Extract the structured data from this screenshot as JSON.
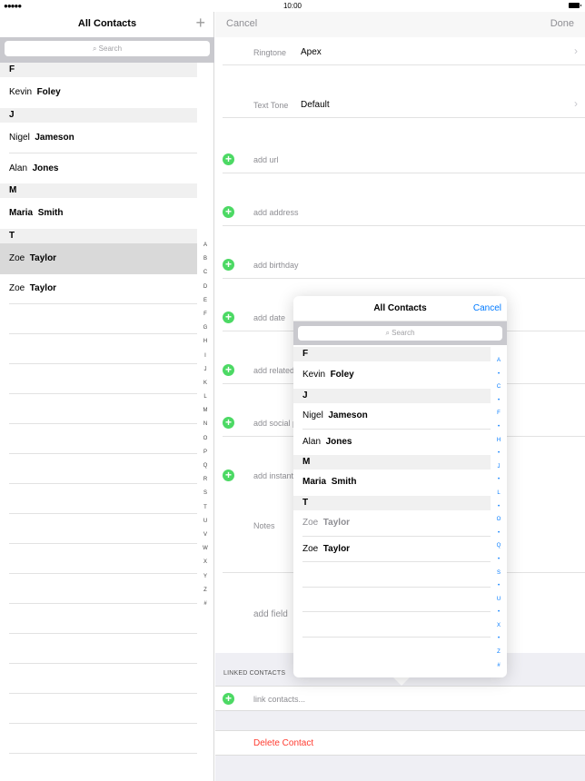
{
  "status_bar": {
    "signal": "●●●●●",
    "time": "10:00"
  },
  "left": {
    "title": "All Contacts",
    "add_icon": "plus-icon",
    "add_label": "+",
    "search_placeholder": "Search",
    "sections": [
      {
        "letter": "F",
        "contacts": [
          {
            "first": "Kevin",
            "last": "Foley"
          }
        ]
      },
      {
        "letter": "J",
        "contacts": [
          {
            "first": "Nigel",
            "last": "Jameson"
          },
          {
            "first": "Alan",
            "last": "Jones"
          }
        ]
      },
      {
        "letter": "M",
        "contacts": [
          {
            "first": "Maria",
            "last": "Smith"
          }
        ]
      },
      {
        "letter": "T",
        "contacts": [
          {
            "first": "Zoe",
            "last": "Taylor",
            "selected": true
          },
          {
            "first": "Zoe",
            "last": "Taylor"
          }
        ]
      }
    ],
    "index": [
      "A",
      "B",
      "C",
      "D",
      "E",
      "F",
      "G",
      "H",
      "I",
      "J",
      "K",
      "L",
      "M",
      "N",
      "O",
      "P",
      "Q",
      "R",
      "S",
      "T",
      "U",
      "V",
      "W",
      "X",
      "Y",
      "Z",
      "#"
    ]
  },
  "right": {
    "cancel_label": "Cancel",
    "done_label": "Done",
    "ringtone_label": "Ringtone",
    "ringtone_value": "Apex",
    "texttone_label": "Text Tone",
    "texttone_value": "Default",
    "chevron": "›",
    "add_url": "add url",
    "add_address": "add address",
    "add_birthday": "add birthday",
    "add_date": "add date",
    "add_related": "add related name",
    "add_social": "add social profile",
    "add_instant": "add instant message",
    "notes_placeholder": "Notes",
    "add_field": "add field",
    "linked_header": "LINKED CONTACTS",
    "link_contacts": "link contacts...",
    "delete_contact": "Delete Contact"
  },
  "popover": {
    "title": "All Contacts",
    "cancel_label": "Cancel",
    "search_placeholder": "Search",
    "sections": [
      {
        "letter": "F",
        "contacts": [
          {
            "first": "Kevin",
            "last": "Foley"
          }
        ]
      },
      {
        "letter": "J",
        "contacts": [
          {
            "first": "Nigel",
            "last": "Jameson"
          },
          {
            "first": "Alan",
            "last": "Jones"
          }
        ]
      },
      {
        "letter": "M",
        "contacts": [
          {
            "first": "Maria",
            "last": "Smith"
          }
        ]
      },
      {
        "letter": "T",
        "contacts": [
          {
            "first": "Zoe",
            "last": "Taylor",
            "dim": true
          },
          {
            "first": "Zoe",
            "last": "Taylor"
          }
        ]
      }
    ],
    "index": [
      "A",
      "•",
      "C",
      "•",
      "F",
      "•",
      "H",
      "•",
      "J",
      "•",
      "L",
      "•",
      "O",
      "•",
      "Q",
      "•",
      "S",
      "•",
      "U",
      "•",
      "X",
      "•",
      "Z",
      "#"
    ]
  },
  "colors": {
    "accent": "#007aff",
    "add_green": "#4cd964",
    "delete_red": "#ff3b30"
  }
}
